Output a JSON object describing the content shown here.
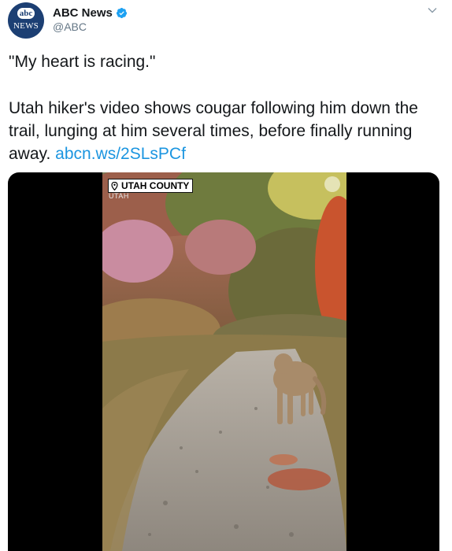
{
  "author": {
    "display_name": "ABC News",
    "handle": "@ABC",
    "avatar_top_text": "abc",
    "avatar_bottom_text": "NEWS",
    "verified": true
  },
  "tweet": {
    "quote": "\"My heart is racing.\"",
    "body": "Utah hiker's video shows cougar following him down the trail, lunging at him several times, before finally running away.",
    "link_text": "abcn.ws/2SLsPCf"
  },
  "media": {
    "location_label": "UTAH COUNTY",
    "location_sublabel": "UTAH",
    "icons": [
      "location-pin-icon",
      "network-logo-icon"
    ]
  },
  "colors": {
    "link": "#1b95e0",
    "verified": "#1da1f2",
    "avatar_bg": "#1c3f73",
    "secondary_text": "#657786"
  }
}
